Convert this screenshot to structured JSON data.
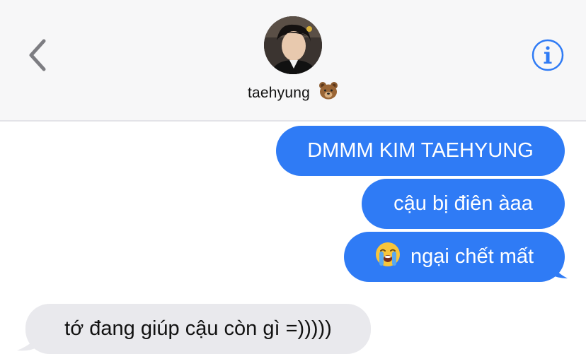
{
  "header": {
    "contact_name": "taehyung",
    "name_emoji": "bear-face-icon",
    "back_icon": "chevron-left-icon",
    "info_icon": "info-circle-icon",
    "accent_color": "#2f7bf5"
  },
  "messages": [
    {
      "direction": "outgoing",
      "text": "DMMM KIM TAEHYUNG"
    },
    {
      "direction": "outgoing",
      "text": "cậu bị điên àaa"
    },
    {
      "direction": "outgoing",
      "emoji": "loudly-crying-face-icon",
      "text": "ngại chết mất"
    },
    {
      "direction": "incoming",
      "text": "tớ đang giúp cậu còn gì =)))))"
    }
  ],
  "colors": {
    "outgoing_bubble": "#2f7bf5",
    "incoming_bubble": "#e9e9ed",
    "header_bg": "#f7f7f8"
  }
}
